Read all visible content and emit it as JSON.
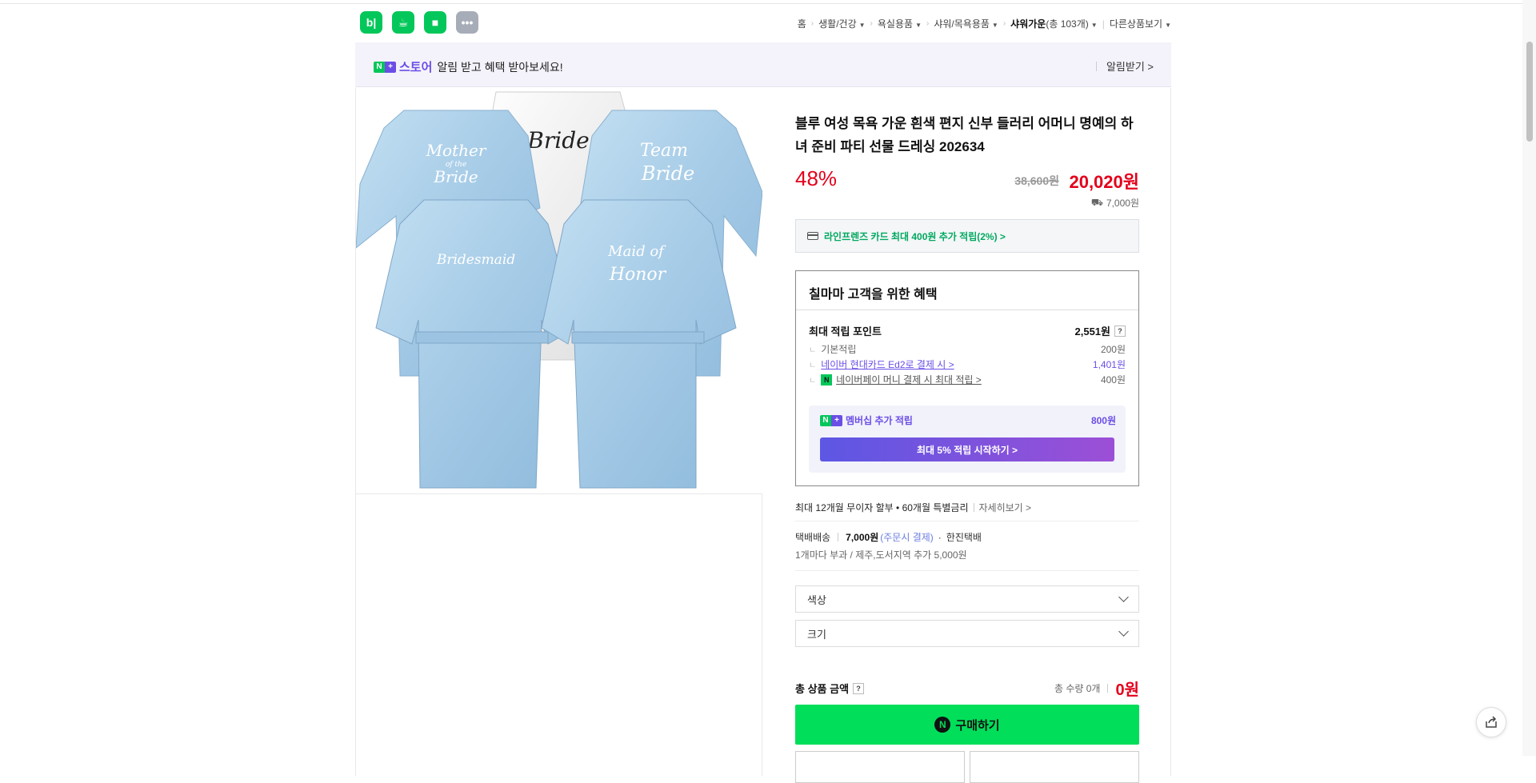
{
  "header": {
    "app_icons": [
      "blog-icon",
      "cafe-icon",
      "bookmark-icon",
      "more-icon"
    ],
    "app_icon_glyphs": [
      "b|",
      "☕",
      "■",
      "•••"
    ],
    "breadcrumb": [
      {
        "label": "홈"
      },
      {
        "label": "생활/건강"
      },
      {
        "label": "욕실용품"
      },
      {
        "label": "샤워/목욕용품"
      }
    ],
    "current_category": "샤워가운",
    "current_count": "(총 103개)",
    "other_products": "다른상품보기"
  },
  "banner": {
    "store_label": "스토어",
    "message": "알림 받고 혜택 받아보세요!",
    "notify_label": "알림받기 >"
  },
  "product": {
    "title": "블루 여성 목욕 가운 흰색 편지 신부 들러리 어머니 명예의 하녀 준비 파티 선물 드레싱 202634",
    "discount": "48%",
    "original_price": "38,600원",
    "sale_price": "20,020원",
    "shipping_fee": "7,000원",
    "card_offer": "라인프렌즈 카드 최대 400원 추가 적립(2%) >"
  },
  "benefit": {
    "title": "칠마마 고객을 위한 혜택",
    "max_points_label": "최대 적립 포인트",
    "max_points_value": "2,551원",
    "rows": [
      {
        "label": "기본적립",
        "value": "200원"
      },
      {
        "label": "네이버 현대카드 Ed2로 결제 시 >",
        "value": "1,401원"
      },
      {
        "label": "네이버페이 머니 결제 시 최대 적립 >",
        "value": "400원"
      }
    ],
    "membership_label": "멤버십 추가 적립",
    "membership_value": "800원",
    "membership_button": "최대 5% 적립 시작하기 >"
  },
  "installment": {
    "text": "최대 12개월 무이자 할부 • 60개월 특별금리",
    "more": "자세히보기 >"
  },
  "delivery": {
    "type": "택배배송",
    "fee": "7,000원",
    "fee_note": "(주문시 결제)",
    "carrier": "한진택배",
    "note": "1개마다 부과 / 제주,도서지역 추가 5,000원"
  },
  "options": {
    "color_placeholder": "색상",
    "size_placeholder": "크기"
  },
  "total": {
    "label": "총 상품 금액",
    "quantity": "총 수량 0개",
    "amount": "0원"
  },
  "buy_button": "구매하기",
  "image_texts": {
    "robe1": "Mother of the Bride",
    "robe2": "Bride",
    "robe3": "Team Bride",
    "robe4": "Bridesmaid",
    "robe5": "Maid of Honor"
  },
  "colors": {
    "naver_green": "#03c75a",
    "sale_red": "#e3001b",
    "plus_purple": "#6b4ee6",
    "robe_blue": "#a9cde8",
    "robe_white": "#f2f2f2"
  }
}
